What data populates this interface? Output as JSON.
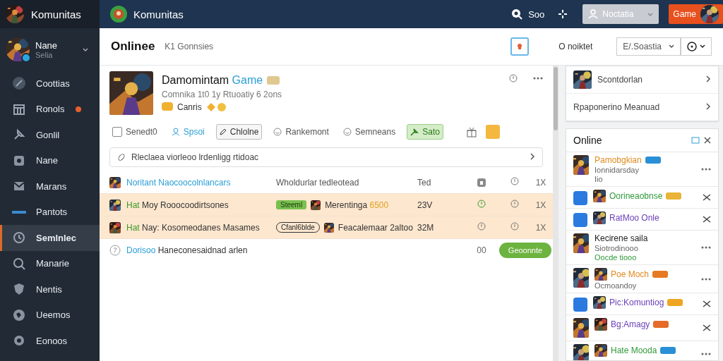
{
  "sidebar": {
    "brand": "Komunitas",
    "user": {
      "name": "Nane",
      "status": "Selia"
    },
    "items": [
      {
        "label": "Coottias",
        "selected": false,
        "badge": false
      },
      {
        "label": "Ronols",
        "selected": false,
        "badge": true
      },
      {
        "label": "Gonlil",
        "selected": false,
        "badge": false
      },
      {
        "label": "Nane",
        "selected": false,
        "badge": false
      },
      {
        "label": "Marans",
        "selected": false,
        "badge": false
      },
      {
        "label": "Pantots",
        "selected": false,
        "badge": false
      },
      {
        "label": "Semlnlec",
        "selected": true,
        "badge": false
      },
      {
        "label": "Manarie",
        "selected": false,
        "badge": false
      },
      {
        "label": "Nentis",
        "selected": false,
        "badge": false
      },
      {
        "label": "Ueemos",
        "selected": false,
        "badge": false
      },
      {
        "label": "Eonoos",
        "selected": false,
        "badge": false
      }
    ]
  },
  "topbar": {
    "title": "Komunitas",
    "link": "Soo",
    "account": "Noctatia",
    "cta": "Game"
  },
  "header": {
    "title": "Onlinee",
    "subtitle": "K1 Gonnsies",
    "filter": "O noiktet",
    "select": "E/.Soastia"
  },
  "game": {
    "title": "Damomintam",
    "tag": "Game",
    "meta": "Comnika 1t0 1y Rtuoatiy 6 2ons",
    "chip": "Canris"
  },
  "actions": [
    {
      "label": "Senedt0",
      "kind": "check",
      "checked": false
    },
    {
      "label": "Spsoi",
      "kind": "link"
    },
    {
      "label": "Chlolne",
      "kind": "outline"
    },
    {
      "label": "Rankemont",
      "kind": "plain"
    },
    {
      "label": "Semneans",
      "kind": "plain"
    },
    {
      "label": "Sato",
      "kind": "primary"
    }
  ],
  "notice": "Rleclaea viorleoo lrdenligg rtidoac",
  "table": {
    "rows": [
      {
        "kind": "header",
        "selected": false,
        "lead": "Noritant Naocoocolnlancars",
        "color": "#2a9fd6",
        "text": "",
        "mid": "Wholdurlar tedleotead",
        "value": "Ted",
        "x": "1X"
      },
      {
        "kind": "entry",
        "selected": true,
        "lead": "Hat",
        "color": "#3b9a2a",
        "text": "Moy Rooocoodirtsones",
        "badge": {
          "label": "Steeml",
          "kind": "filled"
        },
        "game": "Merentinga",
        "amount": "6500",
        "value": "23V",
        "x": "1X"
      },
      {
        "kind": "entry",
        "selected": true,
        "lead": "Hat",
        "color": "#3b9a2a",
        "text": "Nay: Kosomeodanes Masames",
        "badge": {
          "label": "Cfanl6blde",
          "kind": "outline"
        },
        "game": "Feacalemaar 2altoo",
        "value": "32M",
        "x": "1X"
      },
      {
        "kind": "footer",
        "selected": false,
        "lead": "Dorisoo",
        "color": "#2a9fd6",
        "text": "Haneconesaidnad arlen",
        "value": "00",
        "button": "Geoonnte"
      }
    ]
  },
  "side_card": {
    "name": "Scontdorlan",
    "link": "Rpaponerino Meanuad"
  },
  "online": {
    "title": "Online",
    "people": [
      {
        "kind": "more",
        "name": "Pamobgkian",
        "color": "#e08a1e",
        "tag": {
          "color": "#2a8fd6"
        },
        "sub": "Ionnidarsday",
        "sub2": "Iio"
      },
      {
        "kind": "swap",
        "name": "Oorineaobnse",
        "color": "#2f9a3a",
        "tag": {
          "color": "#e9b437"
        }
      },
      {
        "kind": "swap",
        "name": "RatMoo Onle",
        "color": "#6a3fb8"
      },
      {
        "kind": "more",
        "name": "Kecirene saila",
        "color": "#222222",
        "sub": "Siotrodinooo",
        "sub2": "Oocde tiooo"
      },
      {
        "kind": "more",
        "name": "Poe Moch",
        "color": "#e08a1e",
        "tag": {
          "color": "#e67a22"
        },
        "sub": "Ocmoandoy"
      },
      {
        "kind": "swap",
        "name": "Pic:Komuntiog",
        "color": "#6a3fb8",
        "tag": {
          "color": "#efa520"
        }
      },
      {
        "kind": "swap",
        "name": "Bg:Amagy",
        "color": "#6a3fb8",
        "tag": {
          "color": "#e66a2a"
        }
      },
      {
        "kind": "more",
        "name": "Hate Mooda",
        "color": "#2f9a3a",
        "tag": {
          "color": "#2a8fd6"
        }
      }
    ]
  }
}
